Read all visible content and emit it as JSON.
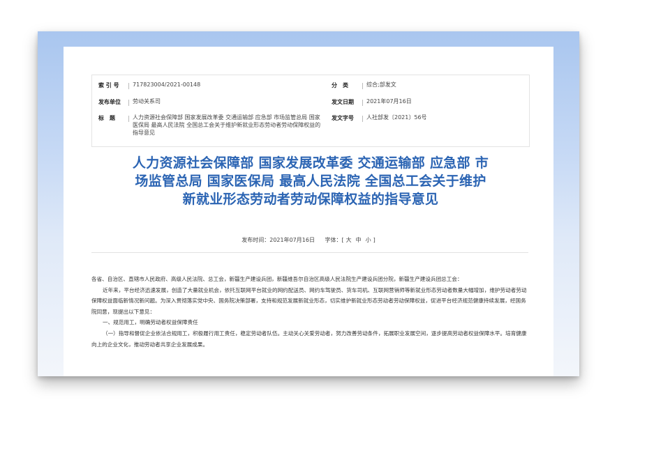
{
  "meta": {
    "index_label": "索 引 号",
    "index_value": "717823004/2021-00148",
    "category_label": "分　类",
    "category_value": "综合;部发文",
    "issuer_label": "发布单位",
    "issuer_value": "劳动关系司",
    "date_label": "发文日期",
    "date_value": "2021年07月16日",
    "title_label": "标　题",
    "title_value": "人力资源社会保障部 国家发展改革委 交通运输部 应急部 市场监管总局 国家医保局 最高人民法院 全国总工会关于维护新就业形态劳动者劳动保障权益的指导意见",
    "docno_label": "发文字号",
    "docno_value": "人社部发〔2021〕56号"
  },
  "title": {
    "line1": "人力资源社会保障部 国家发展改革委 交通运输部 应急部 市",
    "line2": "场监管总局 国家医保局 最高人民法院 全国总工会关于维护",
    "line3": "新就业形态劳动者劳动保障权益的指导意见"
  },
  "pub": {
    "time": "发布时间：2021年07月16日",
    "fontsize_label": "字体：[",
    "large": "大",
    "medium": "中",
    "small": "小",
    "close": "]"
  },
  "body": {
    "addressee": "各省、自治区、直辖市人民政府、高级人民法院、总工会，新疆生产建设兵团，新疆维吾尔自治区高级人民法院生产建设兵团分院，新疆生产建设兵团总工会：",
    "para1": "近年来，平台经济迅速发展，创造了大量就业机会，依托互联网平台就业的网约配送员、网约车驾驶员、货车司机、互联网营销师等新就业形态劳动者数量大幅增加，维护劳动者劳动保障权益面临新情况新问题。为深入贯彻落实党中央、国务院决策部署，支持和规范发展新就业形态，切实维护新就业形态劳动者劳动保障权益，促进平台经济规范健康持续发展，经国务院同意，现提出以下意见：",
    "section1": "一、规范用工，明确劳动者权益保障责任",
    "para2": "（一）指导和督促企业依法合规用工，积极履行用工责任，稳定劳动者队伍。主动关心关爱劳动者，努力改善劳动条件，拓展职业发展空间，逐步提高劳动者权益保障水平。培育健康向上的企业文化，推动劳动者共享企业发展成果。"
  }
}
